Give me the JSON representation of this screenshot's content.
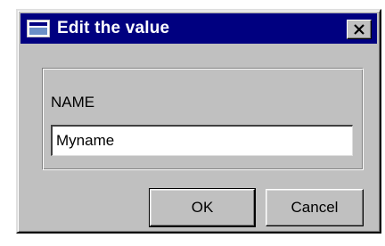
{
  "window": {
    "title": "Edit the value",
    "colors": {
      "titlebar": "#000080",
      "face": "#c0c0c0"
    }
  },
  "icons": {
    "app": "window-icon",
    "close": "close-icon"
  },
  "form": {
    "field_label": "NAME",
    "field_value": "Myname"
  },
  "buttons": {
    "ok": "OK",
    "cancel": "Cancel"
  }
}
